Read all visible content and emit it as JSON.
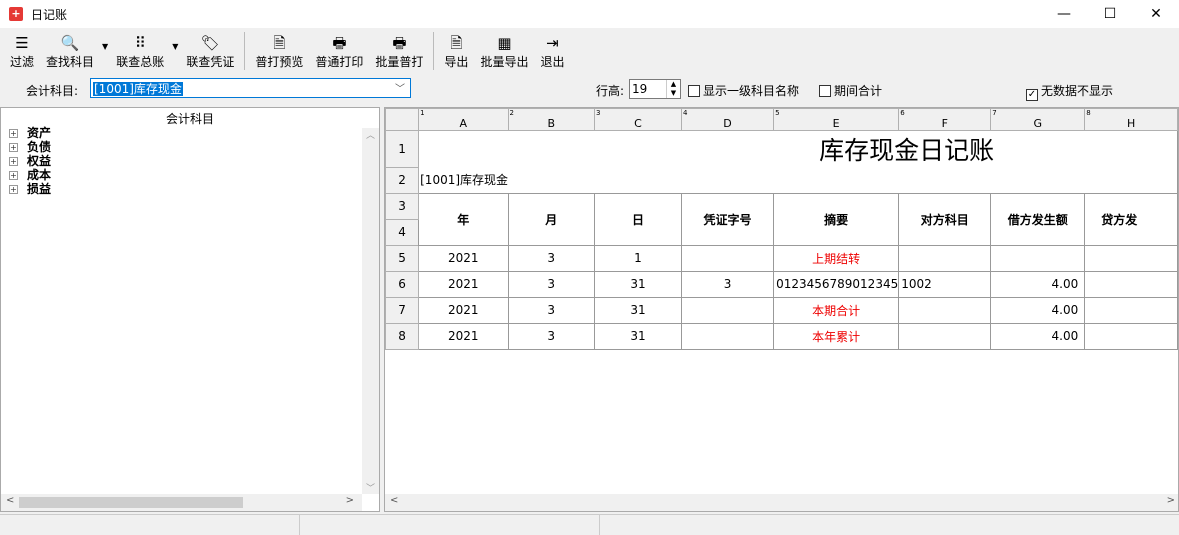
{
  "window": {
    "title": "日记账",
    "minimize": "—",
    "maximize": "☐",
    "close": "✕"
  },
  "toolbar": {
    "items": [
      {
        "label": "过滤",
        "icon": "filter-icon",
        "glyph": "☰"
      },
      {
        "label": "查找科目",
        "icon": "search-icon",
        "glyph": "🔍"
      },
      {
        "label": "联查总账",
        "icon": "grid-icon",
        "glyph": "⠿"
      },
      {
        "label": "联查凭证",
        "icon": "tag-icon",
        "glyph": "🏷"
      },
      {
        "label": "普打预览",
        "icon": "print-preview-icon",
        "glyph": "🗎"
      },
      {
        "label": "普通打印",
        "icon": "printer-icon",
        "glyph": "🖶"
      },
      {
        "label": "批量普打",
        "icon": "batch-print-icon",
        "glyph": "🖶"
      },
      {
        "label": "导出",
        "icon": "export-icon",
        "glyph": "🗎"
      },
      {
        "label": "批量导出",
        "icon": "excel-icon",
        "glyph": "▦"
      },
      {
        "label": "退出",
        "icon": "exit-icon",
        "glyph": "⇥"
      }
    ]
  },
  "filter": {
    "account_label": "会计科目:",
    "account_value": "[1001]库存现金",
    "row_height_label": "行高:",
    "row_height_value": "19",
    "show_level1": "显示一级科目名称",
    "show_level1_checked": false,
    "period_total": "期间合计",
    "period_total_checked": false,
    "hide_empty": "无数据不显示",
    "hide_empty_checked": true
  },
  "tree": {
    "header": "会计科目",
    "items": [
      "资产",
      "负债",
      "权益",
      "成本",
      "损益"
    ]
  },
  "sheet": {
    "col_letters": [
      "A",
      "B",
      "C",
      "D",
      "E",
      "F",
      "G",
      "H"
    ],
    "col_numbers": [
      "1",
      "2",
      "3",
      "4",
      "5",
      "6",
      "7",
      "8"
    ],
    "row_numbers": [
      "1",
      "2",
      "3",
      "4",
      "5",
      "6",
      "7",
      "8"
    ],
    "title": "库存现金日记账",
    "subtitle": "[1001]库存现金",
    "headers": [
      "年",
      "月",
      "日",
      "凭证字号",
      "摘要",
      "对方科目",
      "借方发生额",
      "贷方发"
    ],
    "rows": [
      {
        "year": "2021",
        "month": "3",
        "day": "1",
        "voucher": "",
        "summary": "上期结转",
        "summary_red": true,
        "contra": "",
        "debit": "",
        "credit": ""
      },
      {
        "year": "2021",
        "month": "3",
        "day": "31",
        "voucher": "3",
        "summary": "0123456789012345",
        "summary_red": false,
        "contra": "1002",
        "debit": "4.00",
        "credit": ""
      },
      {
        "year": "2021",
        "month": "3",
        "day": "31",
        "voucher": "",
        "summary": "本期合计",
        "summary_red": true,
        "contra": "",
        "debit": "4.00",
        "credit": ""
      },
      {
        "year": "2021",
        "month": "3",
        "day": "31",
        "voucher": "",
        "summary": "本年累计",
        "summary_red": true,
        "contra": "",
        "debit": "4.00",
        "credit": ""
      }
    ]
  }
}
